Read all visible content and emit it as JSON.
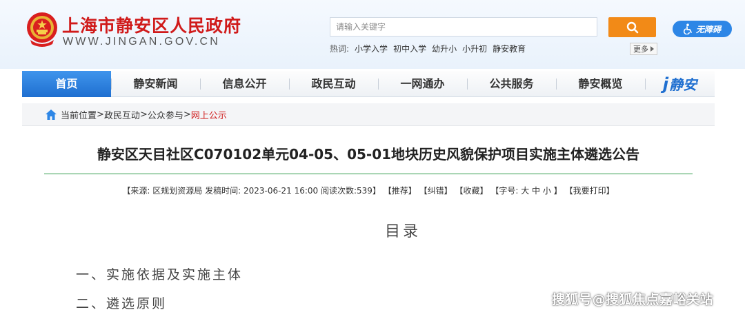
{
  "header": {
    "site_title": "上海市静安区人民政府",
    "site_domain": "WWW.JINGAN.GOV.CN",
    "emblem_icon": "national-emblem-icon"
  },
  "search": {
    "placeholder": "请输入关键字",
    "button_icon": "search-icon"
  },
  "accessibility": {
    "label": "无障碍",
    "icon": "wheelchair-icon"
  },
  "hot_words": {
    "label": "热词:",
    "items": [
      "小学入学",
      "初中入学",
      "幼升小",
      "小升初",
      "静安教育"
    ]
  },
  "more": {
    "label": "更多"
  },
  "nav": {
    "items": [
      {
        "label": "首页",
        "active": true
      },
      {
        "label": "静安新闻"
      },
      {
        "label": "信息公开"
      },
      {
        "label": "政民互动"
      },
      {
        "label": "一网通办"
      },
      {
        "label": "公共服务"
      },
      {
        "label": "静安概览"
      }
    ],
    "logo_mark": "j",
    "logo_text": "静安"
  },
  "breadcrumb": {
    "prefix": "当前位置",
    "sep": ">",
    "items": [
      "政民互动",
      "公众参与"
    ],
    "current": "网上公示"
  },
  "article": {
    "title": "静安区天目社区C070102单元04-05、05-01地块历史风貌保护项目实施主体遴选公告",
    "meta": {
      "source_label": "【来源:",
      "source": "区规划资源局",
      "time_label": "发稿时间:",
      "time": "2023-06-21 16:00",
      "reads_label": "阅读次数:",
      "reads": "539",
      "close_bracket": "】",
      "recommend": "【推荐】",
      "correct": "【纠错】",
      "favorite": "【收藏】",
      "font_label": "【字号:",
      "font_large": "大",
      "font_medium": "中",
      "font_small": "小",
      "font_close": "】",
      "print": "【我要打印】"
    },
    "toc_heading": "目录",
    "outline": [
      "一、实施依据及实施主体",
      "二、遴选原则"
    ]
  },
  "watermark": "搜狐号@搜狐焦点嘉峪关站",
  "colors": {
    "brand_red": "#d01a1a",
    "nav_active_blue": "#1f6fd0",
    "search_orange": "#f28a17",
    "rule_green": "#2e9b4a"
  }
}
